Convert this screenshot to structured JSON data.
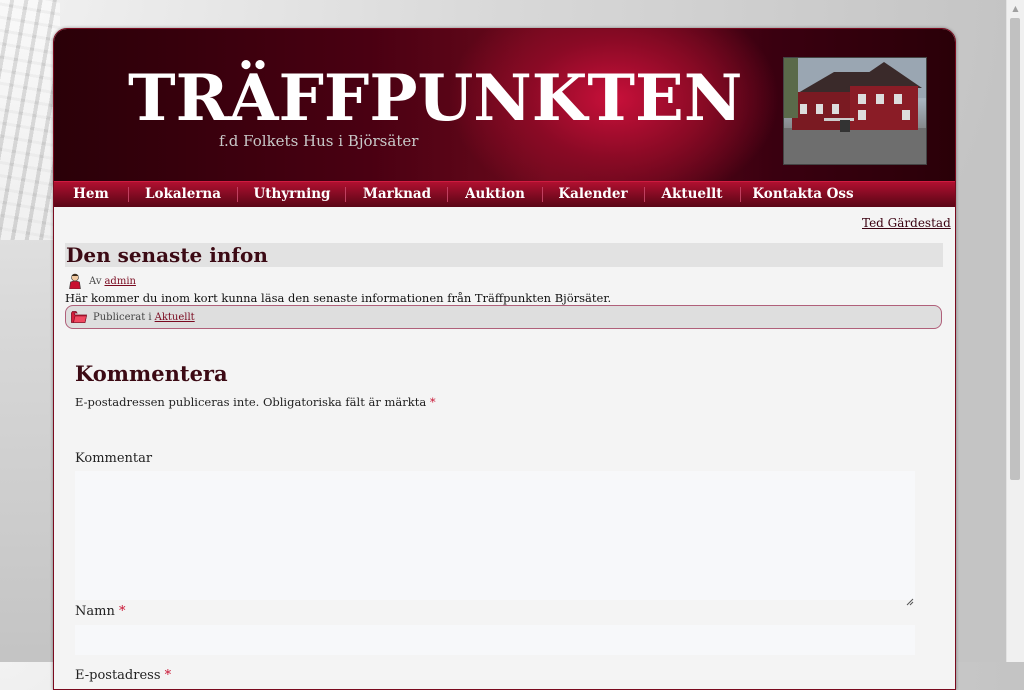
{
  "site": {
    "title": "TRÄFFPUNKTEN",
    "subtitle": "f.d Folkets Hus i Björsäter",
    "header_photo_icon": "building-photo"
  },
  "nav": {
    "items": [
      {
        "label": "Hem"
      },
      {
        "label": "Lokalerna"
      },
      {
        "label": "Uthyrning"
      },
      {
        "label": "Marknad"
      },
      {
        "label": "Auktion"
      },
      {
        "label": "Kalender"
      },
      {
        "label": "Aktuellt"
      },
      {
        "label": "Kontakta Oss"
      }
    ]
  },
  "breadcrumb": {
    "link": "Ted Gärdestad",
    "arrow": "»"
  },
  "post": {
    "title": "Den senaste infon",
    "by_prefix": "Av",
    "author": "admin",
    "body": "Här kommer du inom kort kunna läsa den senaste informationen från Träffpunkten Björsäter.",
    "published_prefix": "Publicerat i",
    "category": "Aktuellt"
  },
  "reply": {
    "title": "Kommentera",
    "notes": "E-postadressen publiceras inte. Obligatoriska fält är märkta",
    "required_mark": "*",
    "comment_label": "Kommentar",
    "name_label": "Namn",
    "email_label": "E-postadress",
    "comment_value": "",
    "name_value": "",
    "email_value": ""
  },
  "colors": {
    "accent": "#7a0a20",
    "heading": "#3c0a14",
    "required": "#c81030"
  }
}
